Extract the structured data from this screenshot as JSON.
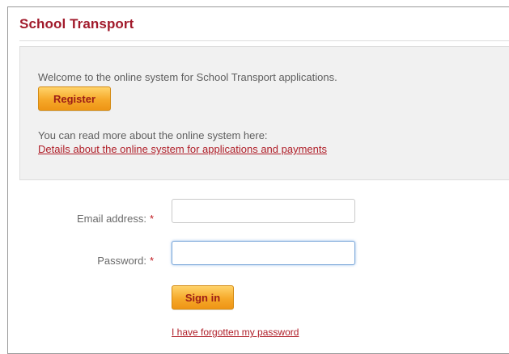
{
  "page": {
    "title": "School Transport"
  },
  "info": {
    "welcome_text": "Welcome to the online system for School Transport applications.",
    "register_label": "Register",
    "read_more_text": "You can read more about the online system here:",
    "details_link": "Details about the online system for applications and payments"
  },
  "login": {
    "email_label": "Email address:",
    "password_label": "Password:",
    "required_marker": "*",
    "email_value": "",
    "password_value": "",
    "signin_label": "Sign in",
    "forgot_link": "I have forgotten my password"
  },
  "colors": {
    "brand_red": "#a11a2b",
    "button_orange": "#f6a92a",
    "link_red": "#b0202a",
    "focus_blue": "#7aa7d9"
  }
}
